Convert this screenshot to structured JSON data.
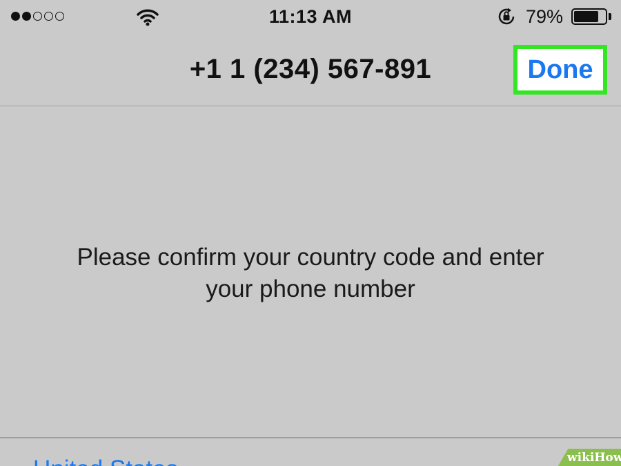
{
  "status_bar": {
    "signal_bars_filled": 2,
    "signal_bars_total": 5,
    "wifi_icon": "wifi-icon",
    "time": "11:13 AM",
    "rotation_lock_icon": "rotation-lock-icon",
    "battery_percent": "79%",
    "battery_level": 0.79
  },
  "nav_bar": {
    "title": "+1 1 (234) 567-891",
    "done_label": "Done",
    "highlight_color": "#34e524",
    "accent_color": "#1a78f0"
  },
  "content": {
    "instructions_line1": "Please confirm your country code and enter",
    "instructions_line2": "your phone number",
    "country": "United States"
  },
  "watermark": {
    "text": "wikiHow"
  }
}
